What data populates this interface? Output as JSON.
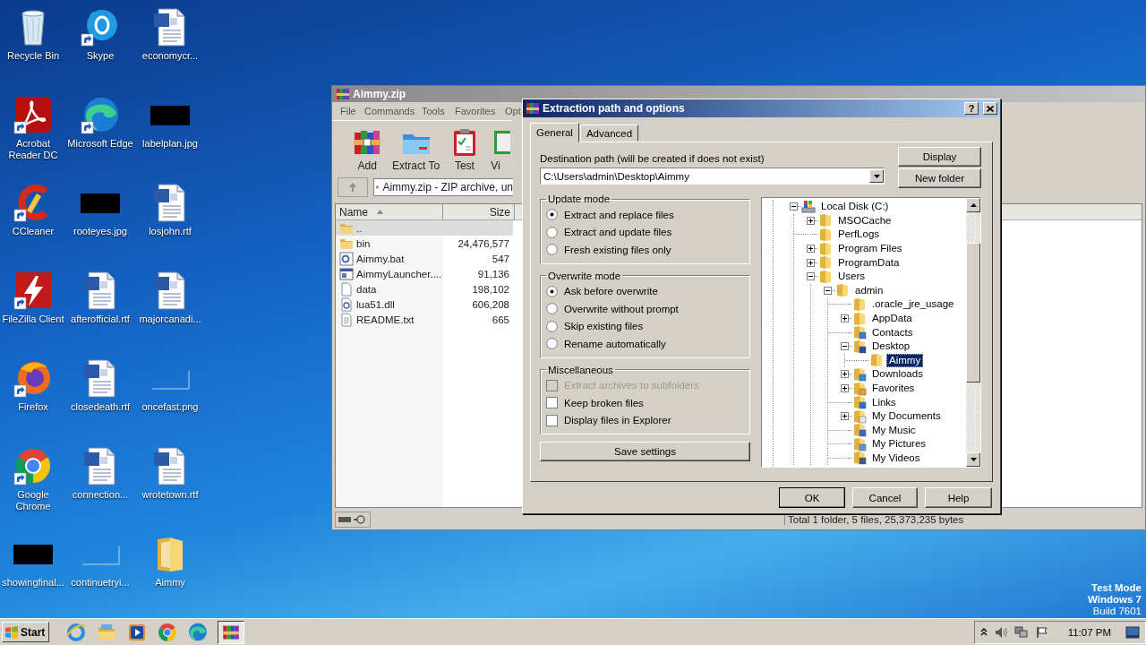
{
  "desktop_icons": [
    {
      "label": "Recycle Bin",
      "kind": "recycle",
      "shortcut": false
    },
    {
      "label": "Skype",
      "kind": "skype",
      "shortcut": true
    },
    {
      "label": "economycr...",
      "kind": "word",
      "shortcut": false
    },
    {
      "label": "Acrobat Reader DC",
      "kind": "acrobat",
      "shortcut": true
    },
    {
      "label": "Microsoft Edge",
      "kind": "edge",
      "shortcut": true
    },
    {
      "label": "labelplan.jpg",
      "kind": "image-dark",
      "shortcut": false
    },
    {
      "label": "CCleaner",
      "kind": "ccleaner",
      "shortcut": true
    },
    {
      "label": "rooteyes.jpg",
      "kind": "image-dark",
      "shortcut": false
    },
    {
      "label": "losjohn.rtf",
      "kind": "word",
      "shortcut": false
    },
    {
      "label": "FileZilla Client",
      "kind": "filezilla",
      "shortcut": true
    },
    {
      "label": "afterofficial.rtf",
      "kind": "word",
      "shortcut": false
    },
    {
      "label": "majorcanadi...",
      "kind": "word",
      "shortcut": false
    },
    {
      "label": "Firefox",
      "kind": "firefox",
      "shortcut": true
    },
    {
      "label": "closedeath.rtf",
      "kind": "word",
      "shortcut": false
    },
    {
      "label": "oncefast.png",
      "kind": "image-blank",
      "shortcut": false
    },
    {
      "label": "Google Chrome",
      "kind": "chrome",
      "shortcut": true
    },
    {
      "label": "connection...",
      "kind": "word",
      "shortcut": false
    },
    {
      "label": "wrotetown.rtf",
      "kind": "word",
      "shortcut": false
    },
    {
      "label": "showingfinal...",
      "kind": "image-dark",
      "shortcut": false
    },
    {
      "label": "continuetryi...",
      "kind": "image-blank",
      "shortcut": false
    },
    {
      "label": "Aimmy",
      "kind": "folder",
      "shortcut": false
    }
  ],
  "os_notice": [
    "Test Mode",
    "Windows 7",
    "Build 7601"
  ],
  "archive_window": {
    "title": "Aimmy.zip",
    "menu": [
      "File",
      "Commands",
      "Tools",
      "Favorites",
      "Opt"
    ],
    "toolbar": [
      {
        "label": "Add",
        "kind": "add"
      },
      {
        "label": "Extract To",
        "kind": "extract"
      },
      {
        "label": "Test",
        "kind": "test"
      },
      {
        "label": "Vi",
        "kind": "view"
      }
    ],
    "address": "Aimmy.zip - ZIP archive, un",
    "columns": [
      {
        "label": "Name",
        "sorted": true
      },
      {
        "label": "Size",
        "sorted": false
      }
    ],
    "files": [
      {
        "name": "..",
        "kind": "folder",
        "selected": true
      },
      {
        "name": "bin",
        "kind": "folder",
        "size": "24,476,577",
        "selected": false
      },
      {
        "name": "Aimmy.bat",
        "kind": "batch",
        "size": "547",
        "selected": false
      },
      {
        "name": "AimmyLauncher....",
        "kind": "exe",
        "size": "91,136",
        "selected": false
      },
      {
        "name": "data",
        "kind": "file",
        "size": "198,102",
        "selected": false
      },
      {
        "name": "lua51.dll",
        "kind": "dll",
        "size": "606,208",
        "selected": false
      },
      {
        "name": "README.txt",
        "kind": "text",
        "size": "665",
        "selected": false
      }
    ],
    "status": "Total 1 folder, 5 files, 25,373,235 bytes"
  },
  "dialog": {
    "title": "Extraction path and options",
    "help_button": "?",
    "tabs": [
      {
        "label": "General",
        "selected": true
      },
      {
        "label": "Advanced",
        "selected": false
      }
    ],
    "destination_label": "Destination path (will be created if does not exist)",
    "destination": "C:\\Users\\admin\\Desktop\\Aimmy",
    "side_buttons": [
      "Display",
      "New folder"
    ],
    "groups": [
      {
        "title": "Update mode",
        "options": [
          {
            "label": "Extract and replace files",
            "kind": "radio",
            "selected": true
          },
          {
            "label": "Extract and update files",
            "kind": "radio",
            "selected": false
          },
          {
            "label": "Fresh existing files only",
            "kind": "radio",
            "selected": false
          }
        ]
      },
      {
        "title": "Overwrite mode",
        "options": [
          {
            "label": "Ask before overwrite",
            "kind": "radio",
            "selected": true
          },
          {
            "label": "Overwrite without prompt",
            "kind": "radio",
            "selected": false
          },
          {
            "label": "Skip existing files",
            "kind": "radio",
            "selected": false
          },
          {
            "label": "Rename automatically",
            "kind": "radio",
            "selected": false
          }
        ]
      },
      {
        "title": "Miscellaneous",
        "options": [
          {
            "label": "Extract archives to subfolders",
            "kind": "checkbox",
            "checked": false,
            "disabled": true
          },
          {
            "label": "Keep broken files",
            "kind": "checkbox",
            "checked": false,
            "disabled": false
          },
          {
            "label": "Display files in Explorer",
            "kind": "checkbox",
            "checked": false,
            "disabled": false
          }
        ]
      }
    ],
    "save_button": "Save settings",
    "tree": [
      {
        "label": "Local Disk (C:)",
        "kind": "drive",
        "expanded": true,
        "selected": false,
        "children": [
          {
            "label": "MSOCache",
            "kind": "folder",
            "expanded": false,
            "selected": false
          },
          {
            "label": "PerfLogs",
            "kind": "folder",
            "selected": false
          },
          {
            "label": "Program Files",
            "kind": "folder",
            "expanded": false,
            "selected": false
          },
          {
            "label": "ProgramData",
            "kind": "folder",
            "expanded": false,
            "selected": false
          },
          {
            "label": "Users",
            "kind": "folder",
            "expanded": true,
            "selected": false,
            "children": [
              {
                "label": "admin",
                "kind": "folder",
                "expanded": true,
                "selected": false,
                "children": [
                  {
                    "label": ".oracle_jre_usage",
                    "kind": "folder",
                    "selected": false
                  },
                  {
                    "label": "AppData",
                    "kind": "folder",
                    "expanded": false,
                    "selected": false
                  },
                  {
                    "label": "Contacts",
                    "kind": "contacts",
                    "selected": false
                  },
                  {
                    "label": "Desktop",
                    "kind": "desktop",
                    "expanded": true,
                    "selected": false,
                    "children": [
                      {
                        "label": "Aimmy",
                        "kind": "folder",
                        "selected": true
                      }
                    ]
                  },
                  {
                    "label": "Downloads",
                    "kind": "downloads",
                    "expanded": false,
                    "selected": false
                  },
                  {
                    "label": "Favorites",
                    "kind": "favorites",
                    "expanded": false,
                    "selected": false
                  },
                  {
                    "label": "Links",
                    "kind": "links",
                    "selected": false
                  },
                  {
                    "label": "My Documents",
                    "kind": "documents",
                    "expanded": false,
                    "selected": false
                  },
                  {
                    "label": "My Music",
                    "kind": "music",
                    "selected": false
                  },
                  {
                    "label": "My Pictures",
                    "kind": "pictures",
                    "selected": false
                  },
                  {
                    "label": "My Videos",
                    "kind": "videos",
                    "selected": false
                  }
                ]
              }
            ]
          }
        ]
      }
    ],
    "buttons": [
      "OK",
      "Cancel",
      "Help"
    ]
  },
  "taskbar": {
    "start": "Start",
    "pinned": [
      {
        "kind": "ie",
        "active": false
      },
      {
        "kind": "explorer",
        "active": false
      },
      {
        "kind": "media",
        "active": false
      },
      {
        "kind": "chrome",
        "active": false
      },
      {
        "kind": "edge",
        "active": false
      },
      {
        "kind": "winrar",
        "active": true
      }
    ],
    "clock": "11:07 PM"
  }
}
